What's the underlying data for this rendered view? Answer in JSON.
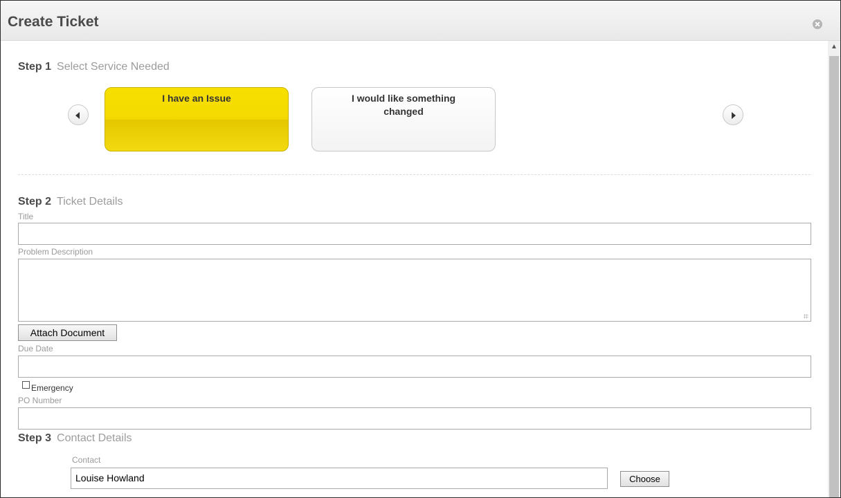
{
  "dialog": {
    "title": "Create Ticket"
  },
  "step1": {
    "number": "Step 1",
    "name": "Select Service Needed",
    "services": [
      {
        "label": "I have an Issue",
        "selected": true
      },
      {
        "label": "I would like something changed",
        "selected": false
      }
    ]
  },
  "step2": {
    "number": "Step 2",
    "name": "Ticket Details",
    "title_label": "Title",
    "title_value": "",
    "problem_label": "Problem Description",
    "problem_value": "",
    "attach_label": "Attach Document",
    "due_date_label": "Due Date",
    "due_date_value": "",
    "emergency_label": "Emergency",
    "emergency_checked": false,
    "po_label": "PO Number",
    "po_value": ""
  },
  "step3": {
    "number": "Step 3",
    "name": "Contact Details",
    "contact_label": "Contact",
    "contact_value": "Louise Howland",
    "choose_label": "Choose"
  },
  "colors": {
    "selected_card": "#f4d900",
    "accent_text": "#9c9c9c"
  },
  "icons": {
    "close": "close-icon",
    "prev": "arrow-left-icon",
    "next": "arrow-right-icon"
  }
}
